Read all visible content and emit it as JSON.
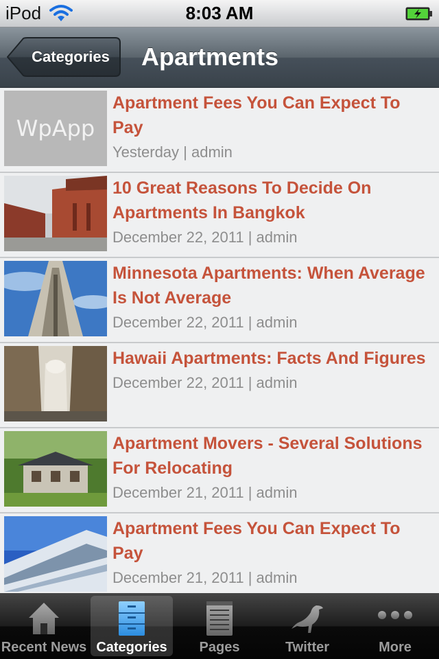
{
  "status_bar": {
    "carrier": "iPod",
    "time": "8:03 AM"
  },
  "nav_bar": {
    "back_label": "Categories",
    "title": "Apartments"
  },
  "posts": [
    {
      "title": "Apartment Fees You Can Expect To Pay",
      "meta": "Yesterday | admin",
      "thumb": "placeholder",
      "placeholder_text": "WpApp"
    },
    {
      "title": "10 Great Reasons To Decide On Apartments In Bangkok",
      "meta": "December 22, 2011 | admin",
      "thumb": "brick-warehouse"
    },
    {
      "title": "Minnesota Apartments: When Average Is Not Average",
      "meta": "December 22, 2011 | admin",
      "thumb": "cathedral-tower"
    },
    {
      "title": "Hawaii Apartments: Facts And Figures",
      "meta": "December 22, 2011 | admin",
      "thumb": "city-street"
    },
    {
      "title": "Apartment Movers - Several Solutions For Relocating",
      "meta": "December 21, 2011 | admin",
      "thumb": "house-in-trees"
    },
    {
      "title": "Apartment Fees You Can Expect To Pay",
      "meta": "December 21, 2011 | admin",
      "thumb": "glass-highrise"
    }
  ],
  "tab_bar": {
    "selected": "Categories",
    "tabs": [
      {
        "label": "Recent News",
        "icon": "house-icon"
      },
      {
        "label": "Categories",
        "icon": "file-cabinet-icon"
      },
      {
        "label": "Pages",
        "icon": "notepad-icon"
      },
      {
        "label": "Twitter",
        "icon": "bird-icon"
      },
      {
        "label": "More",
        "icon": "ellipsis-icon"
      }
    ]
  },
  "colors": {
    "post_title": "#c5533b",
    "post_meta": "#8d8d8d",
    "row_bg": "#eff0f1",
    "tab_selected_icon": "#3aa0e6"
  }
}
